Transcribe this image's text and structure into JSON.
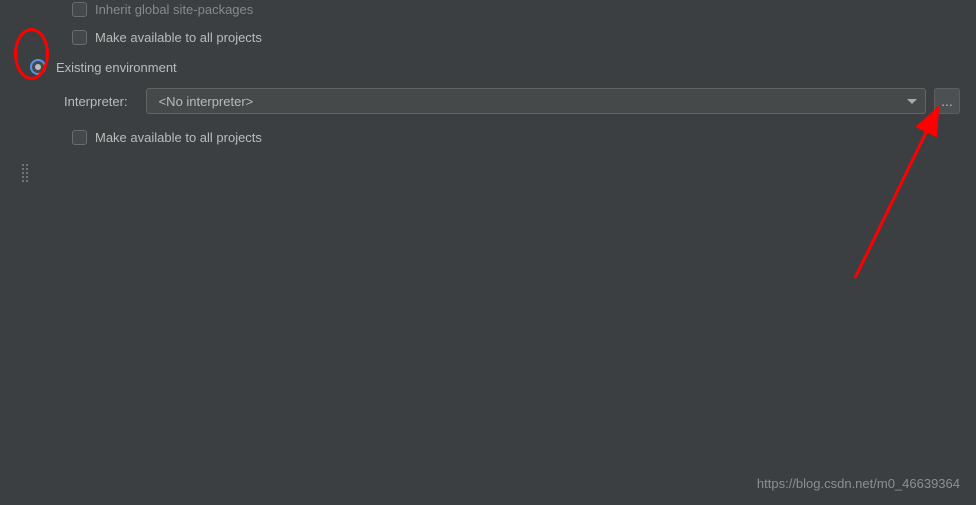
{
  "options": {
    "inherit_label": "Inherit global site-packages",
    "make_available_1_label": "Make available to all projects",
    "existing_env_label": "Existing environment",
    "interpreter_label": "Interpreter:",
    "interpreter_value": "<No interpreter>",
    "make_available_2_label": "Make available to all projects",
    "browse_label": "..."
  },
  "watermark": "https://blog.csdn.net/m0_46639364"
}
